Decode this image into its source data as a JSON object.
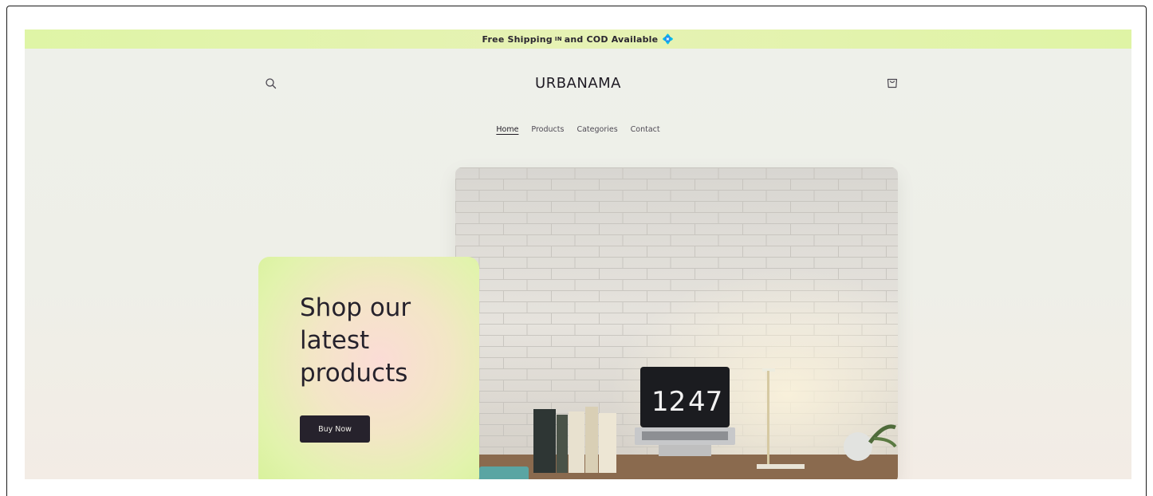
{
  "announcement": {
    "text_before": "Free Shipping",
    "flag": "IN",
    "text_after": "and COD Available",
    "gem": "💠"
  },
  "header": {
    "logo": "URBANAMA",
    "icons": {
      "search": "search-icon",
      "cart": "cart-icon"
    }
  },
  "nav": {
    "items": [
      {
        "label": "Home",
        "active": true
      },
      {
        "label": "Products",
        "active": false
      },
      {
        "label": "Categories",
        "active": false
      },
      {
        "label": "Contact",
        "active": false
      }
    ]
  },
  "hero": {
    "heading": "Shop our latest products",
    "button_label": "Buy Now",
    "image": {
      "clock_hours": "12",
      "clock_minutes": "47"
    }
  },
  "colors": {
    "announcement_bg": "#e1f4aa",
    "page_bg": "#eef0ea",
    "button_bg": "#26222c",
    "card_green": "#d9f29c",
    "card_pink": "#fbdcd6"
  }
}
